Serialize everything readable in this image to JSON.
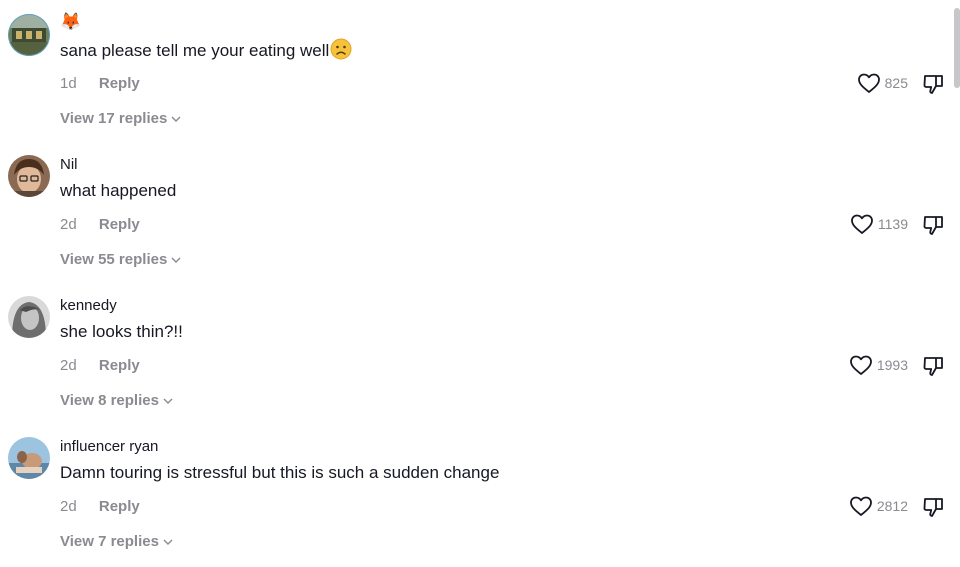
{
  "comments": [
    {
      "username": "🦊",
      "text": "sana please tell me your eating well",
      "time": "1d",
      "reply_label": "Reply",
      "replies_label": "View 17 replies",
      "likes": "825"
    },
    {
      "username": "Nil",
      "text": "what happened",
      "time": "2d",
      "reply_label": "Reply",
      "replies_label": "View 55 replies",
      "likes": "1139"
    },
    {
      "username": "kennedy",
      "text": "she looks thin?!!",
      "time": "2d",
      "reply_label": "Reply",
      "replies_label": "View 8 replies",
      "likes": "1993"
    },
    {
      "username": "influencer ryan",
      "text": "Damn touring is stressful but this is such a sudden change",
      "time": "2d",
      "reply_label": "Reply",
      "replies_label": "View 7 replies",
      "likes": "2812"
    }
  ],
  "colors": {
    "text": "#161823",
    "muted": "#8a8b91",
    "background": "#ffffff"
  },
  "icons": {
    "like": "heart-icon",
    "dislike": "thumbs-down-icon",
    "expand": "chevron-down-icon",
    "emoji": "frowning-face-emoji"
  }
}
